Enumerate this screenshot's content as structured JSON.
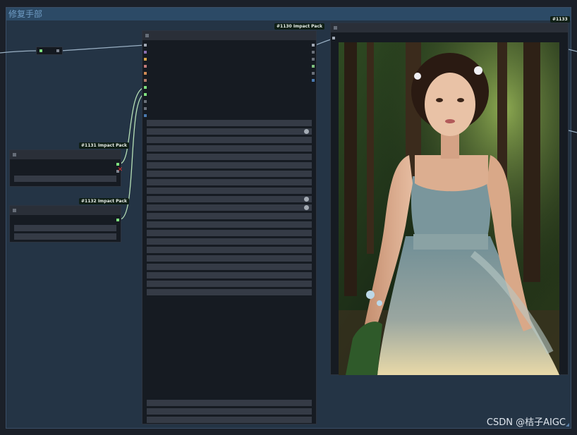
{
  "group": {
    "title": "修复手部"
  },
  "nodes": {
    "main": {
      "badge": "#1130 Impact Pack"
    },
    "n1131": {
      "badge": "#1131 Impact Pack"
    },
    "n1132": {
      "badge": "#1132 Impact Pack"
    },
    "preview": {
      "badge": "#1133"
    }
  },
  "watermark": "CSDN @桔子AIGC",
  "colors": {
    "accent_green": "#7ee07e",
    "link": "#9ab0c4",
    "link_green": "#b6e0b6",
    "error_red": "#e03030",
    "group_bg": "#243445"
  }
}
